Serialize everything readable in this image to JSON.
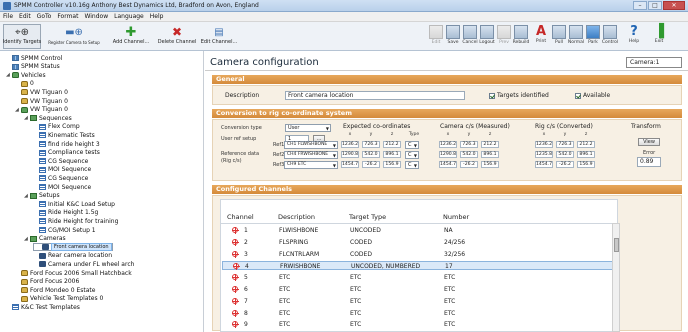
{
  "window": {
    "title": "SPMM Controller v10.16g Anthony Best Dynamics Ltd, Bradford on Avon, England"
  },
  "menu": [
    "File",
    "Edit",
    "GoTo",
    "Format",
    "Window",
    "Language",
    "Help"
  ],
  "toolbar_left": [
    {
      "label": "Identify Targets",
      "icon": "targets-icon"
    },
    {
      "label": "Register Camera to Setup",
      "icon": "register-camera-icon"
    },
    {
      "label": "Add Channel...",
      "icon": "add-icon"
    },
    {
      "label": "Delete Channel",
      "icon": "delete-icon"
    },
    {
      "label": "Edit Channel...",
      "icon": "edit-channel-icon"
    }
  ],
  "toolbar_right": [
    {
      "label": "Edit",
      "dim": true
    },
    {
      "label": "Save",
      "dim": false
    },
    {
      "label": "Cancel",
      "dim": false
    },
    {
      "label": "Logout",
      "dim": false
    },
    {
      "label": "Prev",
      "dim": true
    },
    {
      "label": "Rebuild",
      "dim": false
    },
    {
      "label": "Print",
      "dim": false
    },
    {
      "label": "Pull",
      "dim": false
    },
    {
      "label": "Normal",
      "dim": false
    },
    {
      "label": "Park",
      "dim": false,
      "active": true
    },
    {
      "label": "Control",
      "dim": false
    },
    {
      "label": "Help",
      "dim": false
    },
    {
      "label": "Exit",
      "dim": false
    }
  ],
  "tree": [
    {
      "label": "SPMM Control",
      "icon": "grid",
      "indent": 0
    },
    {
      "label": "SPMM Status",
      "icon": "grid",
      "indent": 0
    },
    {
      "label": "Vehicles",
      "icon": "carg",
      "indent": 0,
      "exp": "◢"
    },
    {
      "label": "0",
      "icon": "car",
      "indent": 1
    },
    {
      "label": "VW Tiguan  0",
      "icon": "car",
      "indent": 1
    },
    {
      "label": "VW Tiguan  0",
      "icon": "car",
      "indent": 1
    },
    {
      "label": "VW Tiguan  0",
      "icon": "carg",
      "indent": 1,
      "exp": "◢"
    },
    {
      "label": "Sequences",
      "icon": "folder",
      "indent": 2,
      "exp": "◢"
    },
    {
      "label": "Flex Comp",
      "icon": "list",
      "indent": 3
    },
    {
      "label": "Kinematic Tests",
      "icon": "list",
      "indent": 3
    },
    {
      "label": "find ride height 3",
      "icon": "list",
      "indent": 3
    },
    {
      "label": "Compliance tests",
      "icon": "list",
      "indent": 3
    },
    {
      "label": "CG Sequence",
      "icon": "list",
      "indent": 3
    },
    {
      "label": "MOI Sequence",
      "icon": "list",
      "indent": 3
    },
    {
      "label": "CG Sequence",
      "icon": "list",
      "indent": 3
    },
    {
      "label": "MOI Sequence",
      "icon": "list",
      "indent": 3
    },
    {
      "label": "Setups",
      "icon": "folder",
      "indent": 2,
      "exp": "◢"
    },
    {
      "label": "Initial K&C Load Setup",
      "icon": "list",
      "indent": 3
    },
    {
      "label": "Ride Height 1.5g",
      "icon": "list",
      "indent": 3
    },
    {
      "label": "Ride Height for training",
      "icon": "list",
      "indent": 3
    },
    {
      "label": "CG/MOI Setup 1",
      "icon": "list",
      "indent": 3
    },
    {
      "label": "Cameras",
      "icon": "folder",
      "indent": 2,
      "exp": "◢"
    },
    {
      "label": "Front camera location",
      "icon": "cam",
      "indent": 3,
      "selected": true
    },
    {
      "label": "Rear camera location",
      "icon": "cam",
      "indent": 3
    },
    {
      "label": "Camera under FL wheel arch",
      "icon": "cam",
      "indent": 3
    },
    {
      "label": "Ford  Focus 2006  Small Hatchback",
      "icon": "car",
      "indent": 1
    },
    {
      "label": "Ford  Focus  2006",
      "icon": "car",
      "indent": 1
    },
    {
      "label": "Ford  Mondeo  0  Estate",
      "icon": "car",
      "indent": 1
    },
    {
      "label": "Vehicle Test Templates  0",
      "icon": "car",
      "indent": 1
    },
    {
      "label": "K&C Test Templates",
      "icon": "list",
      "indent": 0
    }
  ],
  "panel": {
    "title": "Camera configuration",
    "camera_id": "Camera:1",
    "general": {
      "header": "General",
      "description_label": "Description",
      "description_value": "Front camera location",
      "targets_label": "Targets identified",
      "available_label": "Available"
    },
    "conversion": {
      "header": "Conversion to rig co-ordinate system",
      "conv_type_label": "Conversion type",
      "conv_type_value": "User",
      "user_ref_label": "User ref setup",
      "user_ref_value": "1",
      "ref_btn": "...",
      "ref_data_label": "Reference data",
      "ref_data_sub": "(Rig c/s)",
      "expected_header": "Expected co-ordinates",
      "measured_header": "Camera c/s (Measured)",
      "converted_header": "Rig c/s (Converted)",
      "transform_header": "Transform",
      "view_btn": "View",
      "error_label": "Error",
      "error_value": "0.89",
      "xyz": [
        "x",
        "y",
        "z"
      ],
      "type_label": "Type",
      "refs": [
        {
          "ref": "Ref1",
          "name": "CH1 FLWISHBONE",
          "exp": [
            "1236.2",
            "726.3",
            "212.2"
          ],
          "type": "C",
          "meas": [
            "1236.2",
            "726.3",
            "212.2"
          ],
          "conv": [
            "1236.2",
            "726.3",
            "212.2"
          ]
        },
        {
          "ref": "Ref2",
          "name": "CH4 FRWISHBONE",
          "exp": [
            "1290.8",
            "542.0",
            "896.1"
          ],
          "type": "C",
          "meas": [
            "1290.8",
            "542.0",
            "896.1"
          ],
          "conv": [
            "1235.8",
            "542.0",
            "896.1"
          ]
        },
        {
          "ref": "Ref3",
          "name": "CH9 ETC",
          "exp": [
            "1454.7",
            "-26.2",
            "156.9"
          ],
          "type": "C",
          "meas": [
            "1454.7",
            "-26.2",
            "156.9"
          ],
          "conv": [
            "1454.7",
            "-26.2",
            "156.9"
          ]
        }
      ]
    },
    "channels": {
      "header": "Configured Channels",
      "columns": [
        "Channel",
        "Description",
        "Target Type",
        "Number"
      ],
      "rows": [
        {
          "ch": "1",
          "desc": "FLWISHBONE",
          "type": "UNCODED",
          "num": "NA"
        },
        {
          "ch": "2",
          "desc": "FLSPRING",
          "type": "CODED",
          "num": "24/256"
        },
        {
          "ch": "3",
          "desc": "FLCNTRLARM",
          "type": "CODED",
          "num": "32/256"
        },
        {
          "ch": "4",
          "desc": "FRWISHBONE",
          "type": "UNCODED, NUMBERED",
          "num": "17",
          "hl": true
        },
        {
          "ch": "5",
          "desc": "ETC",
          "type": "ETC",
          "num": "ETC"
        },
        {
          "ch": "6",
          "desc": "ETC",
          "type": "ETC",
          "num": "ETC"
        },
        {
          "ch": "7",
          "desc": "ETC",
          "type": "ETC",
          "num": "ETC"
        },
        {
          "ch": "8",
          "desc": "ETC",
          "type": "ETC",
          "num": "ETC"
        },
        {
          "ch": "9",
          "desc": "ETC",
          "type": "ETC",
          "num": "ETC"
        }
      ]
    }
  }
}
